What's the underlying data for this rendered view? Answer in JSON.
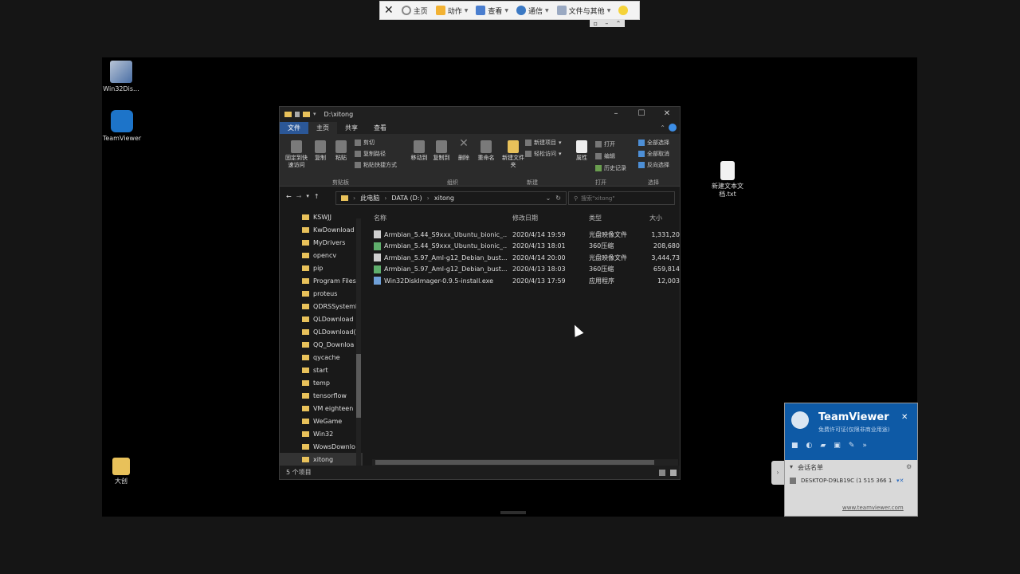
{
  "toolbar": {
    "items": [
      {
        "label": "主页",
        "icon": "home-icon"
      },
      {
        "label": "动作",
        "icon": "lightning-icon"
      },
      {
        "label": "查看",
        "icon": "monitor-icon"
      },
      {
        "label": "通信",
        "icon": "phone-icon"
      },
      {
        "label": "文件与其他",
        "icon": "file-transfer-icon"
      }
    ],
    "close_icon": "close-icon",
    "smiley_icon": "smiley-icon"
  },
  "desktop_icons": [
    {
      "label": "Win32Dis...",
      "icon": "win32-disk-imager-icon"
    },
    {
      "label": "TeamViewer",
      "icon": "teamviewer-icon"
    },
    {
      "label": "大创",
      "icon": "folder-icon"
    },
    {
      "label": "新建文本文档.txt",
      "icon": "text-file-icon"
    }
  ],
  "explorer": {
    "title": "D:\\xitong",
    "tabs": [
      "文件",
      "主页",
      "共享",
      "查看"
    ],
    "ribbon": {
      "pin": "固定到快速访问",
      "copy": "复制",
      "paste": "粘贴",
      "cut": "剪切",
      "copy_path": "复制路径",
      "paste_shortcut": "粘贴快捷方式",
      "move_to": "移动到",
      "copy_to": "复制到",
      "delete": "删除",
      "rename": "重命名",
      "new_folder": "新建文件夹",
      "new_item": "新建项目",
      "easy_access": "轻松访问",
      "properties": "属性",
      "open": "打开",
      "edit": "编辑",
      "history": "历史记录",
      "select_all": "全部选择",
      "select_none": "全部取消",
      "invert_selection": "反向选择",
      "groups": [
        "剪贴板",
        "组织",
        "新建",
        "打开",
        "选择"
      ]
    },
    "address": [
      "此电脑",
      "DATA (D:)",
      "xitong"
    ],
    "search_placeholder": "搜索\"xitong\"",
    "nav_items": [
      "KSWJJ",
      "KwDownload",
      "MyDrivers",
      "opencv",
      "pip",
      "Program Files",
      "proteus",
      "QDRSSystemI",
      "QLDownload",
      "QLDownload(",
      "QQ_Downloa",
      "qycache",
      "start",
      "temp",
      "tensorflow",
      "VM eighteen",
      "WeGame",
      "Win32",
      "WowsDownlo",
      "xitong"
    ],
    "columns": [
      "名称",
      "修改日期",
      "类型",
      "大小"
    ],
    "files": [
      {
        "name": "Armbian_5.44_S9xxx_Ubuntu_bionic_...",
        "date": "2020/4/14 19:59",
        "type": "光盘映像文件",
        "size": "1,331,20",
        "icon": "disc-image-icon"
      },
      {
        "name": "Armbian_5.44_S9xxx_Ubuntu_bionic_...",
        "date": "2020/4/13 18:01",
        "type": "360压缩",
        "size": "208,680",
        "icon": "archive-icon"
      },
      {
        "name": "Armbian_5.97_Aml-g12_Debian_bust...",
        "date": "2020/4/14 20:00",
        "type": "光盘映像文件",
        "size": "3,444,73",
        "icon": "disc-image-icon"
      },
      {
        "name": "Armbian_5.97_Aml-g12_Debian_bust...",
        "date": "2020/4/13 18:03",
        "type": "360压缩",
        "size": "659,814",
        "icon": "archive-icon"
      },
      {
        "name": "Win32DiskImager-0.9.5-install.exe",
        "date": "2020/4/13 17:59",
        "type": "应用程序",
        "size": "12,003",
        "icon": "installer-icon"
      }
    ],
    "status": "5 个项目"
  },
  "teamviewer": {
    "brand": "TeamViewer",
    "subtitle": "免费许可证(仅限非商业用途)",
    "partners_label": "会话名单",
    "session": "DESKTOP-D9LB19C (1 515 366 1",
    "link": "www.teamviewer.com"
  },
  "colors": {
    "accent": "#2b5797",
    "tv_blue": "#0e5aa6",
    "folder": "#e8c15a"
  }
}
